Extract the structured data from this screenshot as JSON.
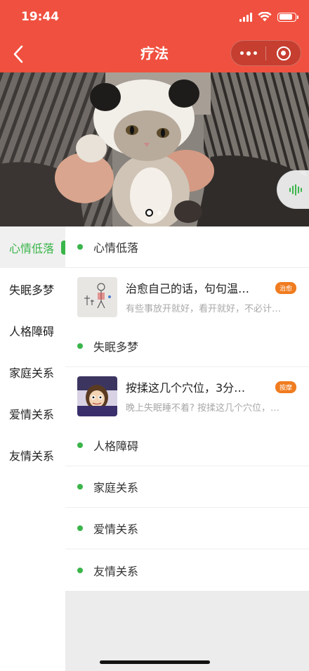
{
  "status": {
    "time": "19:44"
  },
  "nav": {
    "title": "疗法",
    "back_icon": "chevron-left-icon",
    "more_icon": "more-dots-icon",
    "close_icon": "target-circle-icon"
  },
  "colors": {
    "header": "#f0503f",
    "accent": "#3ab54a",
    "tag": "#f07c1f"
  },
  "banner": {
    "image": "cat-in-panda-hat",
    "slides": 2,
    "active_slide": 1,
    "floating_icon": "voice-wave-icon"
  },
  "sidebar": {
    "items": [
      {
        "label": "心情低落",
        "active": true
      },
      {
        "label": "失眠多梦",
        "active": false
      },
      {
        "label": "人格障碍",
        "active": false
      },
      {
        "label": "家庭关系",
        "active": false
      },
      {
        "label": "爱情关系",
        "active": false
      },
      {
        "label": "友情关系",
        "active": false
      }
    ]
  },
  "content": {
    "sections": [
      {
        "label": "心情低落",
        "article": {
          "title": "治愈自己的话，句句温…",
          "tag": "治愈",
          "desc": "有些事放开就好，看开就好，不必计…",
          "thumb": "sketch-figures"
        }
      },
      {
        "label": "失眠多梦",
        "article": {
          "title": "按揉这几个穴位，3分…",
          "tag": "按摩",
          "desc": "晚上失眠睡不着? 按揉这几个穴位，…",
          "thumb": "sleepless-girl"
        }
      },
      {
        "label": "人格障碍"
      },
      {
        "label": "家庭关系"
      },
      {
        "label": "爱情关系"
      },
      {
        "label": "友情关系"
      }
    ]
  }
}
